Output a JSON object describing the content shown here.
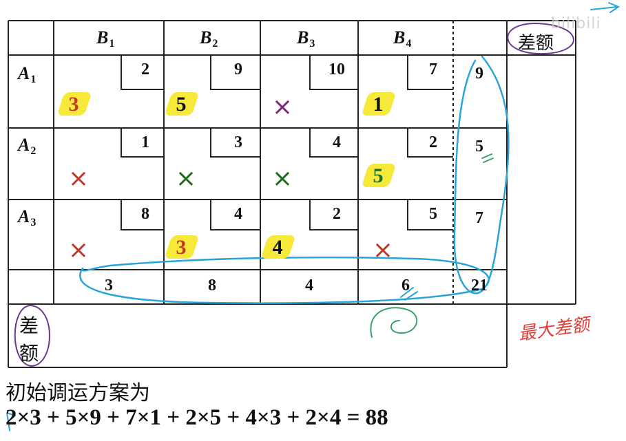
{
  "columns": [
    "B",
    "B",
    "B",
    "B"
  ],
  "column_subs": [
    "1",
    "2",
    "3",
    "4"
  ],
  "rows": [
    "A",
    "A",
    "A"
  ],
  "row_subs": [
    "1",
    "2",
    "3"
  ],
  "diff_label": "差额",
  "diff_label_left": [
    "差",
    "额"
  ],
  "costs": [
    [
      "2",
      "9",
      "10",
      "7"
    ],
    [
      "1",
      "3",
      "4",
      "2"
    ],
    [
      "8",
      "4",
      "2",
      "5"
    ]
  ],
  "allocations": [
    {
      "row": 0,
      "col": 0,
      "value": "3",
      "color": "#c0392b"
    },
    {
      "row": 0,
      "col": 1,
      "value": "5",
      "color": "#111111"
    },
    {
      "row": 0,
      "col": 3,
      "value": "1",
      "color": "#111111"
    },
    {
      "row": 1,
      "col": 3,
      "value": "5",
      "color": "#1e6b1e"
    },
    {
      "row": 2,
      "col": 1,
      "value": "3",
      "color": "#c0392b"
    },
    {
      "row": 2,
      "col": 2,
      "value": "4",
      "color": "#111111"
    }
  ],
  "crosses": [
    {
      "row": 0,
      "col": 2,
      "color": "#7a2b7a"
    },
    {
      "row": 1,
      "col": 0,
      "color": "#c0392b"
    },
    {
      "row": 1,
      "col": 1,
      "color": "#1e6b1e"
    },
    {
      "row": 1,
      "col": 2,
      "color": "#1e6b1e"
    },
    {
      "row": 2,
      "col": 0,
      "color": "#c0392b"
    },
    {
      "row": 2,
      "col": 3,
      "color": "#c0392b"
    }
  ],
  "supplies": [
    "9",
    "5",
    "7"
  ],
  "demands": [
    "3",
    "8",
    "4",
    "6"
  ],
  "total": "21",
  "plan_title": "初始调运方案为",
  "equation": "2×3 + 5×9 + 7×1 + 2×5 + 4×3 + 2×4 = 88",
  "handwritten_note": "最大差额",
  "watermark": "bilibili",
  "colors": {
    "highlight": "#f6e93a",
    "pen_blue": "#2aa3d8",
    "pen_purple": "#6b3a8f",
    "pen_green": "#3aa06b",
    "pen_red": "#e0413a"
  }
}
